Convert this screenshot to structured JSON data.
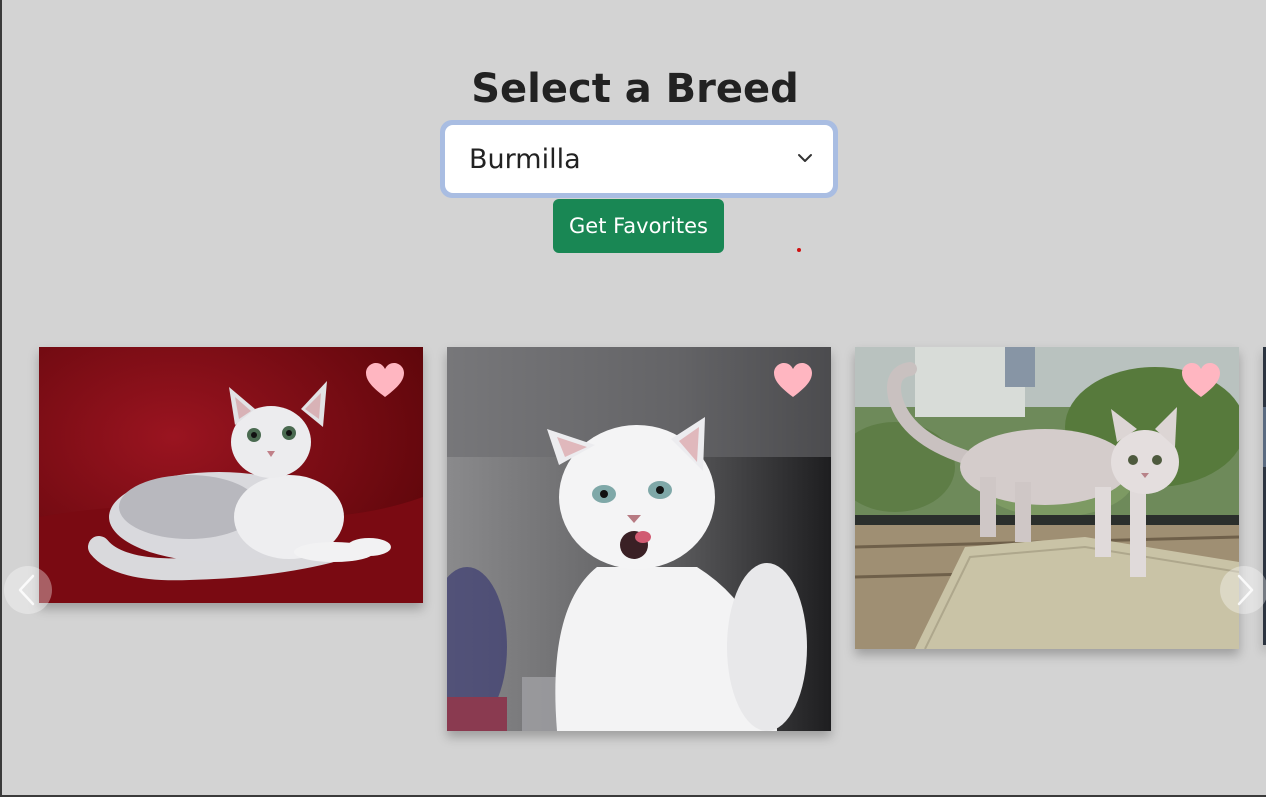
{
  "page": {
    "title": "Select a Breed"
  },
  "breed_select": {
    "selected": "Burmilla",
    "icon": "chevron-down-icon"
  },
  "favorites_button": {
    "label": "Get Favorites",
    "color": "#198754"
  },
  "carousel": {
    "cards": [
      {
        "favorite_icon": "heart-icon",
        "heart_color": "#ffb6c1"
      },
      {
        "favorite_icon": "heart-icon",
        "heart_color": "#ffb6c1"
      },
      {
        "favorite_icon": "heart-icon",
        "heart_color": "#ffb6c1"
      }
    ],
    "prev_icon": "chevron-left-icon",
    "next_icon": "chevron-right-icon"
  },
  "colors": {
    "background": "#d3d3d3",
    "select_focus_ring": "#a9bde2"
  }
}
